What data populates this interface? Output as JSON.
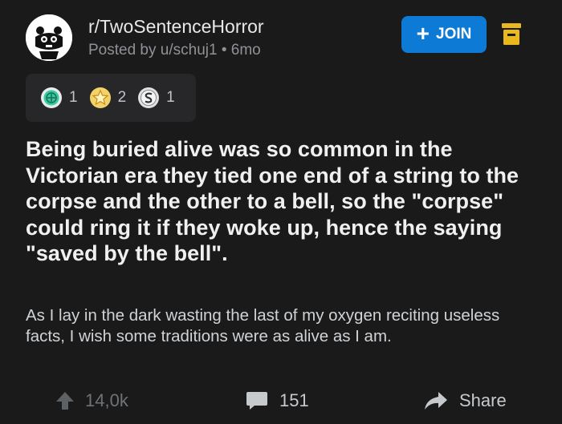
{
  "post": {
    "subreddit": "r/TwoSentenceHorror",
    "posted_by": "Posted by u/schuj1 • 6mo",
    "title": "Being buried alive was so common in the Victorian era they tied one end of a string to the corpse and the other to a bell, so the \"corpse\" could ring it if they woke up, hence the saying \"saved by the bell\".",
    "body": "As I lay in the dark wasting the last of my oxygen reciting useless facts, I wish some traditions were as alive as I am."
  },
  "join_button": {
    "label": "JOIN",
    "icon": "plus-icon",
    "color": "#0d7bd6"
  },
  "bell_icon": "notification-bell-icon",
  "awards": [
    {
      "icon": "helpful-award-icon",
      "count": "1"
    },
    {
      "icon": "star-award-icon",
      "count": "2"
    },
    {
      "icon": "silver-award-icon",
      "count": "1"
    }
  ],
  "actions": {
    "upvotes": "14,0k",
    "comments": "151",
    "share": "Share"
  },
  "colors": {
    "background": "#1a1a1b",
    "award_panel": "#272729",
    "title_text": "#f0f0f0"
  }
}
